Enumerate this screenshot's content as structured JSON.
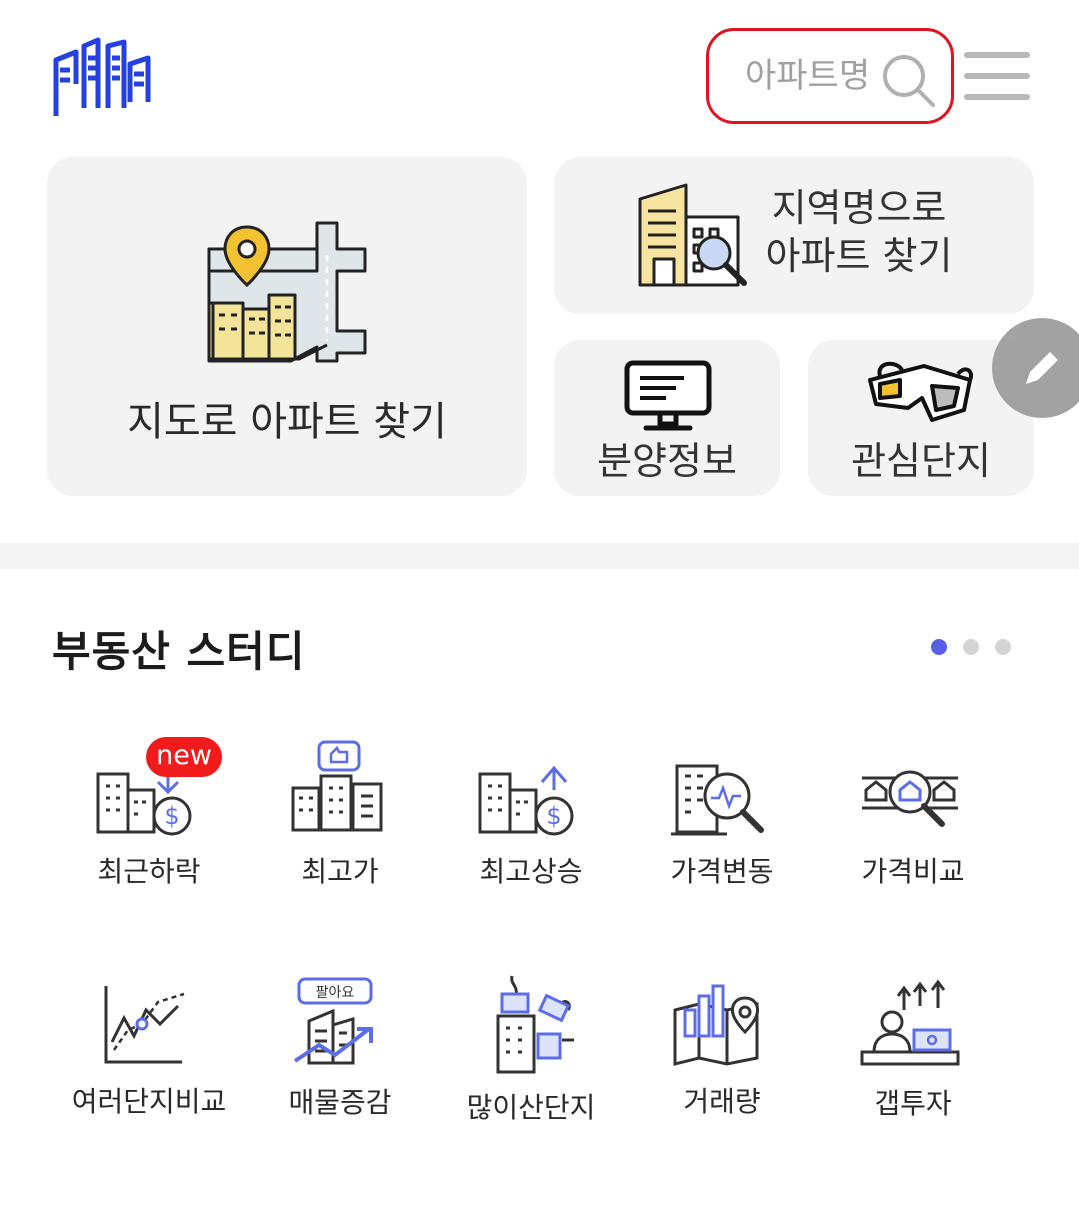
{
  "header": {
    "logo_icon": "buildings-logo-icon",
    "search_placeholder": "아파트명",
    "search_icon": "search-icon",
    "menu_icon": "hamburger-menu-icon"
  },
  "cards": {
    "map_find": "지도로 아파트 찾기",
    "region_find_line1": "지역명으로",
    "region_find_line2": "아파트 찾기",
    "presale": "분양정보",
    "favorites": "관심단지"
  },
  "study": {
    "title": "부동산 스터디",
    "badge": "new",
    "page_dots": {
      "count": 3,
      "active": 0,
      "active_color": "#5b5fe8",
      "inactive_color": "#d4d4d4"
    },
    "items": [
      {
        "label": "최근하락",
        "icon": "price-drop-icon"
      },
      {
        "label": "최고가",
        "icon": "highest-price-icon"
      },
      {
        "label": "최고상승",
        "icon": "highest-rise-icon"
      },
      {
        "label": "가격변동",
        "icon": "price-change-icon"
      },
      {
        "label": "가격비교",
        "icon": "price-compare-icon"
      },
      {
        "label": "여러단지비교",
        "icon": "multi-complex-compare-icon"
      },
      {
        "label": "매물증감",
        "icon": "listing-change-icon"
      },
      {
        "label": "많이산단지",
        "icon": "most-bought-icon"
      },
      {
        "label": "거래량",
        "icon": "trade-volume-icon"
      },
      {
        "label": "갭투자",
        "icon": "gap-investment-icon"
      }
    ],
    "sell_tag": "팔아요"
  },
  "colors": {
    "brand_blue": "#2440e0",
    "search_outline": "#e0141e",
    "accent_blue": "#5b6ee8"
  }
}
